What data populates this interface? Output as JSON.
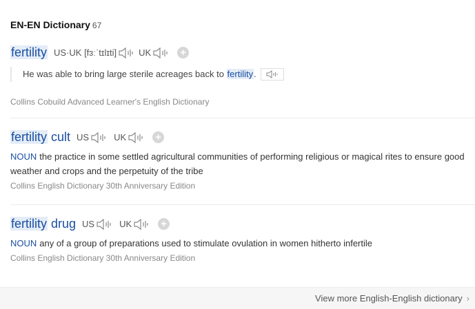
{
  "header": {
    "title": "EN-EN Dictionary",
    "count": "67"
  },
  "entries": [
    {
      "headword": "fertility",
      "headword_rest": "",
      "pron1": "US·UK [fɜːˈtɪlɪti]",
      "pron2": "UK",
      "example_before": "He was able to bring large sterile acreages back to ",
      "example_hl": "fertility",
      "example_after": ".",
      "source": "Collins Cobuild Advanced Learner's English Dictionary"
    },
    {
      "headword": "fertility",
      "headword_rest": " cult",
      "pron1": "US",
      "pron2": "UK",
      "pos": "NOUN",
      "definition": "the practice in some settled agricultural communities of performing religious or magical rites to ensure good weather and crops and the perpetuity of the tribe",
      "source": "Collins English Dictionary 30th Anniversary Edition"
    },
    {
      "headword": "fertility",
      "headword_rest": " drug",
      "pron1": "US",
      "pron2": "UK",
      "pos": "NOUN",
      "definition": "any of a group of preparations used to stimulate ovulation in women hitherto infertile",
      "source": "Collins English Dictionary 30th Anniversary Edition"
    }
  ],
  "footer": {
    "more_label": "View more English-English dictionary",
    "chevron": "›"
  },
  "colors": {
    "headword": "#1a4fa0",
    "highlight": "#e4ecf7"
  }
}
